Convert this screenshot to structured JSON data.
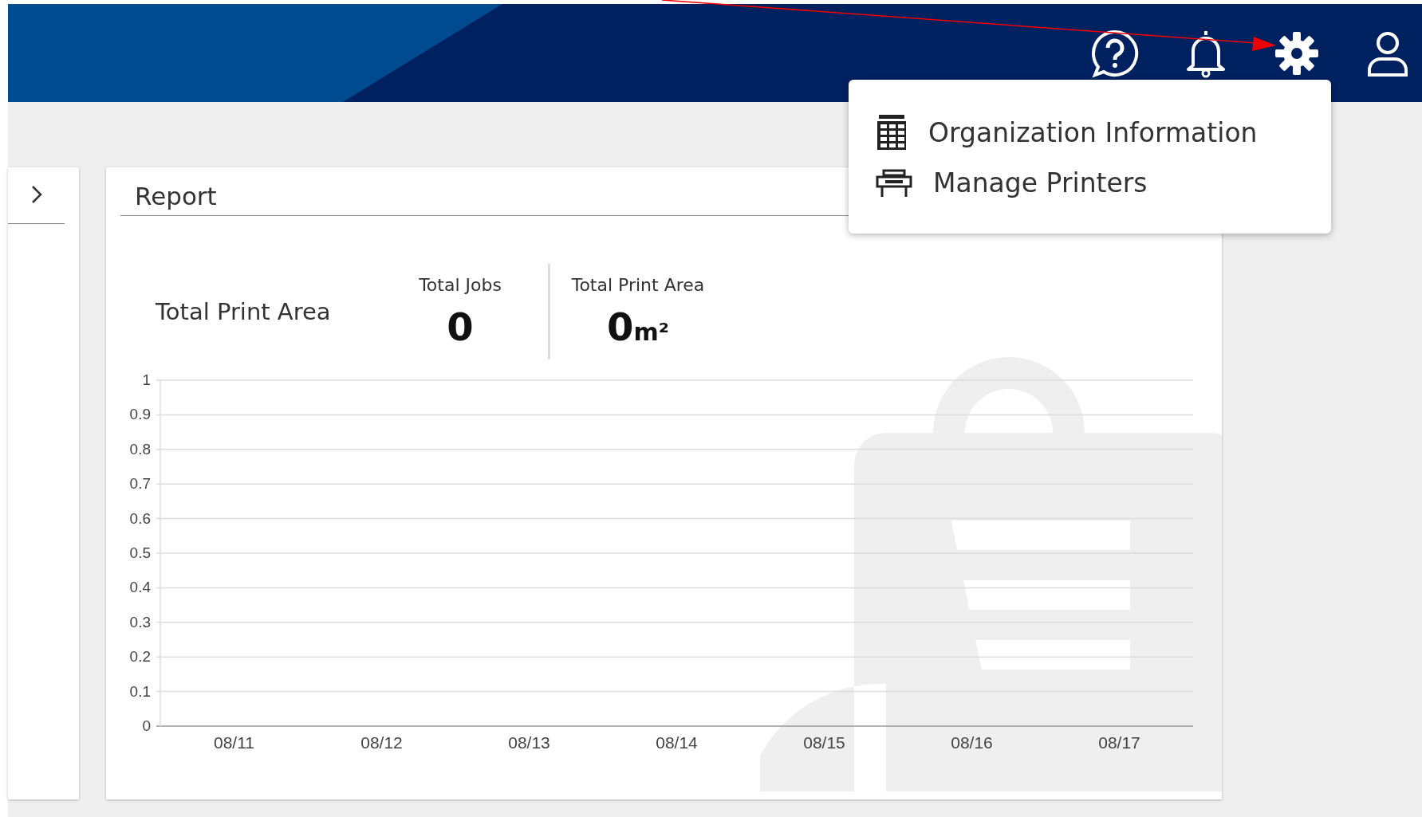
{
  "header": {
    "icons": [
      {
        "kind": "help"
      },
      {
        "kind": "bell"
      },
      {
        "kind": "gear"
      },
      {
        "kind": "user"
      }
    ]
  },
  "settings_menu": {
    "items": [
      {
        "kind": "organization",
        "label": "Organization Information"
      },
      {
        "kind": "printer",
        "label": "Manage Printers"
      }
    ]
  },
  "report": {
    "title": "Report",
    "summary_label": "Total Print Area",
    "stats": [
      {
        "label": "Total Jobs",
        "value": "0"
      },
      {
        "label": "Total Print Area",
        "value": "0",
        "unit": "m²"
      }
    ],
    "chart_data": {
      "type": "line",
      "grid": true,
      "categories": [
        "08/11",
        "08/12",
        "08/13",
        "08/14",
        "08/15",
        "08/16",
        "08/17"
      ],
      "ylim": [
        0,
        1
      ],
      "yticks": [
        {
          "value": 0,
          "label": "0"
        },
        {
          "value": 0.1,
          "label": "0.1"
        },
        {
          "value": 0.2,
          "label": "0.2"
        },
        {
          "value": 0.3,
          "label": "0.3"
        },
        {
          "value": 0.4,
          "label": "0.4"
        },
        {
          "value": 0.5,
          "label": "0.5"
        },
        {
          "value": 0.6,
          "label": "0.6"
        },
        {
          "value": 0.7,
          "label": "0.7"
        },
        {
          "value": 0.8,
          "label": "0.8"
        },
        {
          "value": 0.9,
          "label": "0.9"
        },
        {
          "value": 1,
          "label": "1"
        }
      ]
    }
  }
}
